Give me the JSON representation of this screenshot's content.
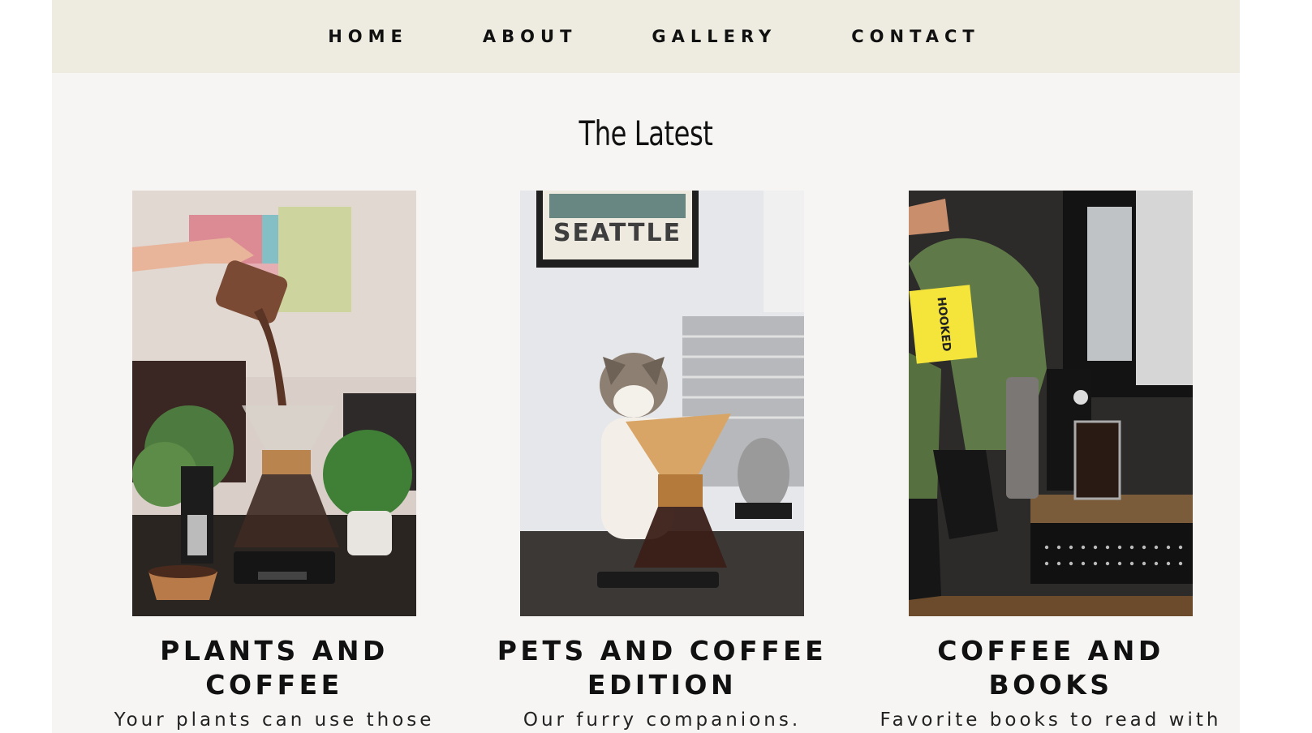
{
  "nav": {
    "items": [
      "HOME",
      "ABOUT",
      "GALLERY",
      "CONTACT"
    ]
  },
  "main": {
    "title": "The Latest",
    "cards": [
      {
        "title": "PLANTS AND COFFEE",
        "description": "Your plants can use those grinds.",
        "image": "coffee-pour-over-plants-photo"
      },
      {
        "title": "PETS AND COFFEE EDITION",
        "description": "Our furry companions.",
        "image": "cat-with-coffee-chemex-photo",
        "poster_text": "SEATTLE"
      },
      {
        "title": "COFFEE AND BOOKS",
        "description": "Favorite books to read with coffee.",
        "image": "person-reading-book-with-coffee-photo",
        "book_text": "HOOKED"
      }
    ]
  },
  "colors": {
    "nav_bg": "#eeece0",
    "page_bg": "#f6f5f3",
    "text": "#111111"
  }
}
